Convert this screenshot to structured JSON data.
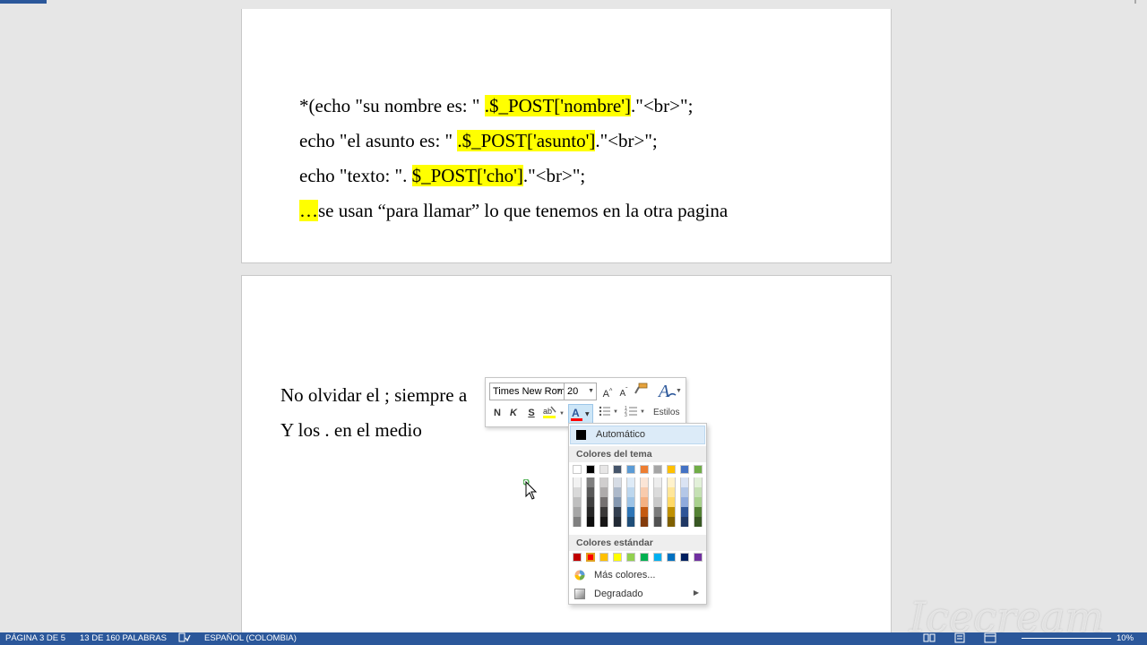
{
  "document": {
    "page1_lines": [
      [
        {
          "t": "*(echo \"su nombre es: \" ",
          "hl": false
        },
        {
          "t": ".$_POST['nombre']",
          "hl": true
        },
        {
          "t": ".\"<br>\";",
          "hl": false
        }
      ],
      [
        {
          "t": "echo \"el asunto es: \" ",
          "hl": false
        },
        {
          "t": ".$_POST['asunto']",
          "hl": true
        },
        {
          "t": ".\"<br>\";",
          "hl": false
        }
      ],
      [
        {
          "t": "echo \"texto: \". ",
          "hl": false
        },
        {
          "t": "$_POST['cho']",
          "hl": true
        },
        {
          "t": ".\"<br>\";",
          "hl": false
        }
      ],
      [
        {
          "t": "…",
          "hl": true
        },
        {
          "t": "se usan “para llamar” lo que tenemos en la otra pagina",
          "hl": false
        }
      ]
    ],
    "page2_lines": [
      "No olvidar el ; siempre a",
      "Y los . en el medio"
    ]
  },
  "minitoolbar": {
    "font_name": "Times New Roman",
    "font_size": "20",
    "bold": "N",
    "italic": "K",
    "underline": "S",
    "styles_label": "Estilos"
  },
  "color_picker": {
    "automatic_label": "Automático",
    "theme_title": "Colores del tema",
    "theme_columns": [
      [
        "#ffffff",
        "#f2f2f2",
        "#d9d9d9",
        "#bfbfbf",
        "#a6a6a6",
        "#808080"
      ],
      [
        "#000000",
        "#7f7f7f",
        "#595959",
        "#404040",
        "#262626",
        "#0d0d0d"
      ],
      [
        "#e7e6e6",
        "#d0cece",
        "#aeabab",
        "#757171",
        "#3a3838",
        "#171616"
      ],
      [
        "#44546a",
        "#d6dce5",
        "#adb9ca",
        "#8497b0",
        "#333f50",
        "#222a35"
      ],
      [
        "#5b9bd5",
        "#deebf7",
        "#bdd7ee",
        "#9dc3e6",
        "#2e75b6",
        "#1f4e79"
      ],
      [
        "#ed7d31",
        "#fbe5d6",
        "#f8cbad",
        "#f4b183",
        "#c55a11",
        "#843c0c"
      ],
      [
        "#a5a5a5",
        "#ededed",
        "#dbdbdb",
        "#c9c9c9",
        "#7b7b7b",
        "#525252"
      ],
      [
        "#ffc000",
        "#fff2cc",
        "#ffe699",
        "#ffd966",
        "#bf9000",
        "#7f6000"
      ],
      [
        "#4472c4",
        "#dae3f3",
        "#b4c7e7",
        "#8faadc",
        "#2f5597",
        "#203864"
      ],
      [
        "#70ad47",
        "#e2f0d9",
        "#c5e0b4",
        "#a9d18e",
        "#548235",
        "#385723"
      ]
    ],
    "standard_title": "Colores estándar",
    "standard_colors": [
      "#c00000",
      "#ff0000",
      "#ffc000",
      "#ffff00",
      "#92d050",
      "#00b050",
      "#00b0f0",
      "#0070c0",
      "#002060",
      "#7030a0"
    ],
    "more_colors_label": "Más colores...",
    "gradient_label": "Degradado"
  },
  "statusbar": {
    "page": "PÁGINA 3 DE 5",
    "words": "13 DE 160 PALABRAS",
    "language": "ESPAÑOL (COLOMBIA)",
    "zoom": "10%"
  },
  "watermark": "Icecream"
}
